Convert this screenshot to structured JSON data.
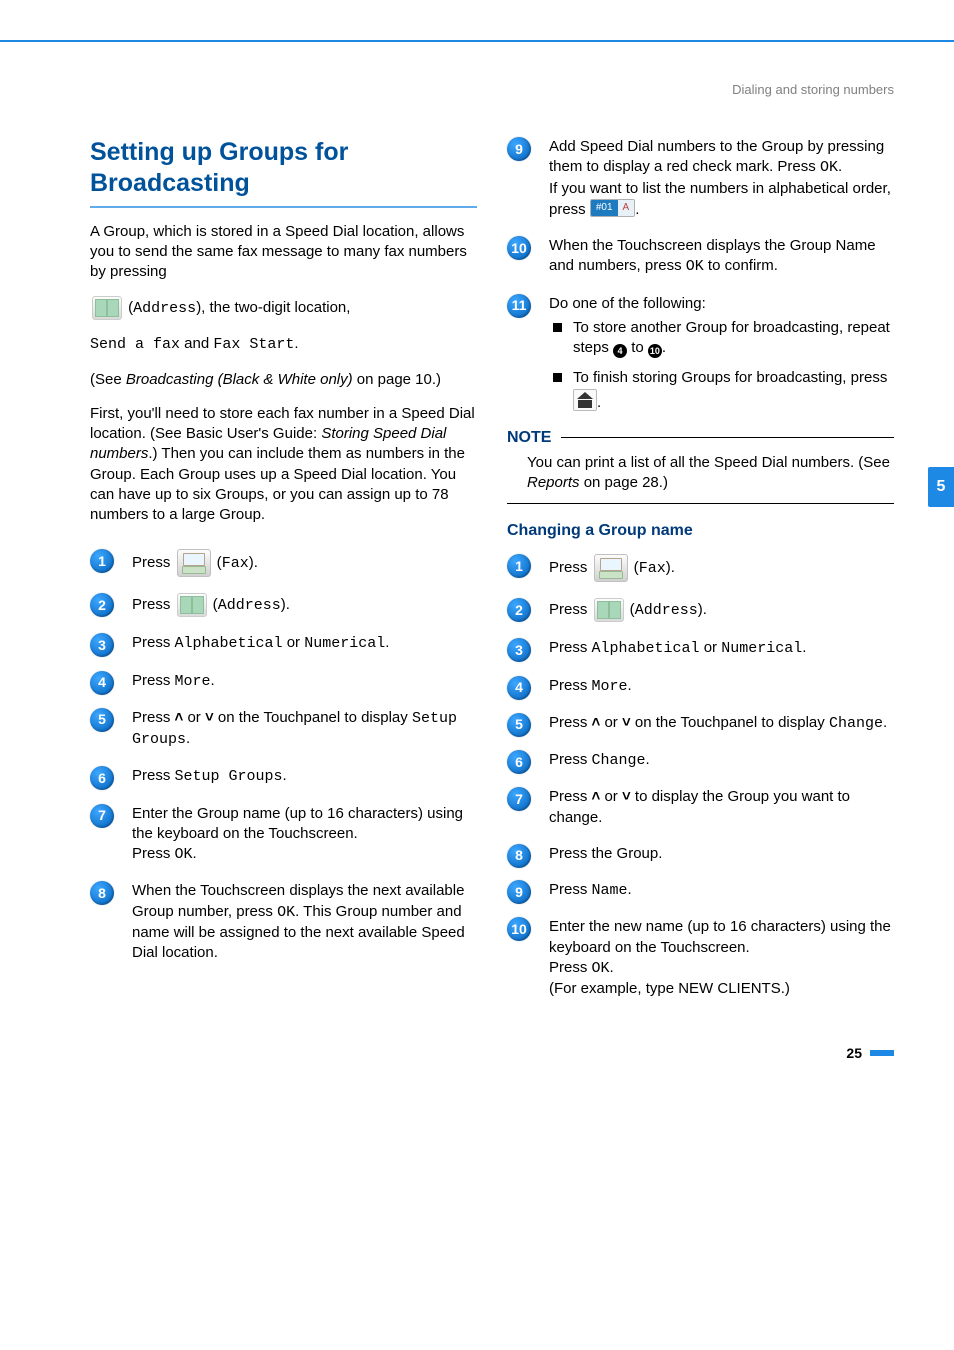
{
  "running_head": "Dialing and storing numbers",
  "side_tab": "5",
  "page_number": "25",
  "section": {
    "title": "Setting up Groups for Broadcasting",
    "intro1a": "A Group, which is stored in a Speed Dial location, allows you to send the same fax message to many fax numbers by pressing",
    "intro1_icon_label": "Address",
    "intro1b": "), the two-digit location, ",
    "intro1c_monoA": "Send a fax",
    "intro1c_and": " and ",
    "intro1c_monoB": "Fax Start",
    "intro1c_period": ".",
    "intro2a": "(See ",
    "intro2b": "Broadcasting (Black & White only)",
    "intro2c": " on page 10.)",
    "intro3a": "First, you'll need to store each fax number in a Speed Dial location. (See Basic User's Guide: ",
    "intro3b": "Storing Speed Dial numbers",
    "intro3c": ".) Then you can include them as numbers in the Group. Each Group uses up a Speed Dial location. You can have up to six Groups, or you can assign up to 78 numbers to a large Group."
  },
  "stepsA": {
    "s1_a": "Press ",
    "s1_b": "Fax",
    "s1_c": ").",
    "s2_a": "Press ",
    "s2_b": "Address",
    "s2_c": ").",
    "s3_a": "Press ",
    "s3_b": "Alphabetical",
    "s3_or": " or ",
    "s3_c": "Numerical",
    "s3_d": ".",
    "s4_a": "Press ",
    "s4_b": "More",
    "s4_c": ".",
    "s5_a": "Press ",
    "s5_or": " or ",
    "s5_b": " on the Touchpanel to display ",
    "s5_c": "Setup Groups",
    "s5_d": ".",
    "s6_a": "Press ",
    "s6_b": "Setup Groups",
    "s6_c": ".",
    "s7_a": "Enter the Group name (up to 16 characters) using the keyboard on the Touchscreen.",
    "s7_b": "Press ",
    "s7_c": "OK",
    "s7_d": ".",
    "s8_a": "When the Touchscreen displays the next available Group number, press ",
    "s8_b": "OK",
    "s8_c": ". This Group number and name will be assigned to the next available Speed Dial location."
  },
  "stepsB": {
    "s9_a": "Add Speed Dial numbers to the Group by pressing them to display a red check mark. Press ",
    "s9_b": "OK",
    "s9_c": ".",
    "s9_d": "If you want to list the numbers in alphabetical order, press ",
    "s10_a": "When the Touchscreen displays the Group Name and numbers, press ",
    "s10_b": "OK",
    "s10_c": " to confirm.",
    "s11_a": "Do one of the following:",
    "s11_b1": "To store another Group for broadcasting, repeat steps ",
    "s11_to": " to ",
    "s11_b1b": ".",
    "s11_b2a": "To finish storing Groups for broadcasting, press ",
    "ref4": "4",
    "ref10": "10"
  },
  "note": {
    "label": "NOTE",
    "body_a": "You can print a list of all the Speed Dial numbers. (See ",
    "body_b": "Reports",
    "body_c": " on page 28.)"
  },
  "changing": {
    "title": "Changing a Group name",
    "s1_a": "Press ",
    "s1_b": "Fax",
    "s1_c": ").",
    "s2_a": "Press ",
    "s2_b": "Address",
    "s2_c": ").",
    "s3_a": "Press ",
    "s3_b": "Alphabetical",
    "s3_or": " or ",
    "s3_c": "Numerical",
    "s3_d": ".",
    "s4_a": "Press ",
    "s4_b": "More",
    "s4_c": ".",
    "s5_a": "Press ",
    "s5_or": " or ",
    "s5_b": " on the Touchpanel to display ",
    "s5_c": "Change",
    "s5_d": ".",
    "s6_a": "Press ",
    "s6_b": "Change",
    "s6_c": ".",
    "s7_a": "Press ",
    "s7_or": " or ",
    "s7_b": " to display the Group you want to change.",
    "s8": "Press the Group.",
    "s9_a": "Press ",
    "s9_b": "Name",
    "s9_c": ".",
    "s10_a": "Enter the new name (up to 16 characters) using the keyboard on the Touchscreen.",
    "s10_b": "Press ",
    "s10_c": "OK",
    "s10_d": ".",
    "s10_e": "(For example, type NEW CLIENTS.)"
  }
}
